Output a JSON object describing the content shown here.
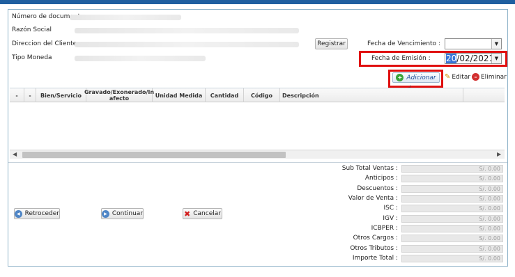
{
  "form": {
    "numero_documento_label": "Número de documento",
    "razon_social_label": "Razón Social",
    "direccion_label": "Direccion del Cliente",
    "tipo_moneda_label": "Tipo Moneda",
    "registrar_label": "Registrar",
    "fecha_vencimiento_label": "Fecha de Vencimiento  :",
    "fecha_vencimiento_value": "",
    "fecha_emision_label": "Fecha de Emisión  :",
    "fecha_emision_day": "20",
    "fecha_emision_rest": "/02/2021"
  },
  "actions": {
    "adicionar": "Adicionar",
    "editar": "Editar",
    "eliminar": "Eliminar"
  },
  "grid": {
    "columns": [
      "-",
      "-",
      "Bien/Servicio",
      "Gravado/Exonerado/Inafecto",
      "Unidad Medida",
      "Cantidad",
      "Código",
      "Descripción"
    ],
    "col_gravado_line1": "Gravado/Exonerado/In",
    "col_gravado_line2": "afecto",
    "rows": []
  },
  "nav": {
    "retroceder": "Retroceder",
    "continuar": "Continuar",
    "cancelar": "Cancelar"
  },
  "totals": [
    {
      "label": "Sub Total Ventas :",
      "value": "S/. 0.00"
    },
    {
      "label": "Anticipos :",
      "value": "S/. 0.00"
    },
    {
      "label": "Descuentos :",
      "value": "S/. 0.00"
    },
    {
      "label": "Valor de Venta :",
      "value": "S/. 0.00"
    },
    {
      "label": "ISC :",
      "value": "S/. 0.00"
    },
    {
      "label": "IGV :",
      "value": "S/. 0.00"
    },
    {
      "label": "ICBPER :",
      "value": "S/. 0.00"
    },
    {
      "label": "Otros Cargos :",
      "value": "S/. 0.00"
    },
    {
      "label": "Otros Tributos :",
      "value": "S/. 0.00"
    },
    {
      "label": "Importe Total :",
      "value": "S/. 0.00"
    }
  ],
  "colors": {
    "highlight_red": "#e01010",
    "header_blue": "#1f5fa0",
    "selection_blue": "#3875d7"
  }
}
